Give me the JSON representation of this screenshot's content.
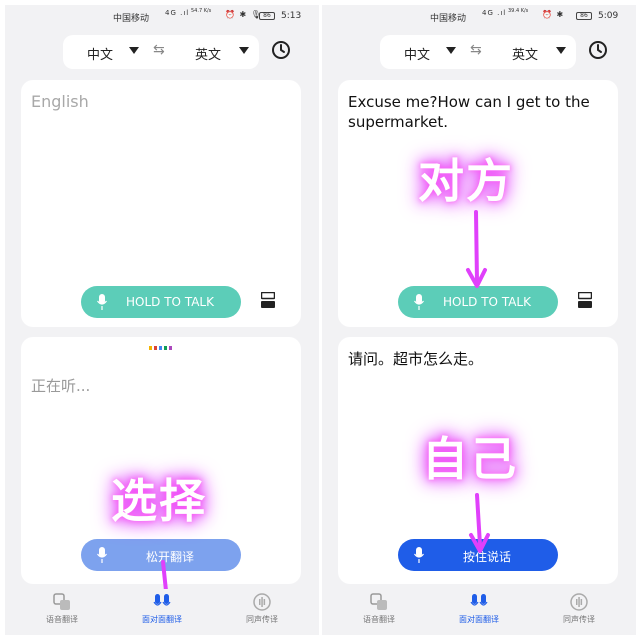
{
  "status_left": {
    "carrier": "中国移动",
    "net": "4G .ıl",
    "speed": "54.7 K/s",
    "icons": "⏰ ✱ 🎙",
    "battery": "86",
    "time": "5:13"
  },
  "status_right": {
    "carrier": "中国移动",
    "net": "4G .ıl",
    "speed": "39.4 K/s",
    "icons": "⏰ ✱",
    "battery": "86",
    "time": "5:09"
  },
  "lang": {
    "source": "中文",
    "target": "英文"
  },
  "left": {
    "top_hint": "English",
    "top_button": "HOLD TO TALK",
    "bottom_status": "正在听...",
    "bottom_button": "松开翻译",
    "overlay": "选择"
  },
  "right": {
    "top_text": "Excuse me?How can I get to the supermarket.",
    "top_button": "HOLD TO TALK",
    "bottom_text": "请问。超市怎么走。",
    "bottom_button": "按住说话",
    "overlay_top": "对方",
    "overlay_bottom": "自己"
  },
  "tabs": [
    "语音翻译",
    "面对面翻译",
    "同声传译"
  ],
  "colors": {
    "teal": "#5ccdb8",
    "blue": "#1f5de8",
    "light_blue": "#7da2ee",
    "magenta": "#e040fb"
  },
  "icons": [
    "history-icon",
    "swap-icon",
    "mic-icon",
    "layout-toggle-icon",
    "voice-translate-icon",
    "face-to-face-icon",
    "simultaneous-icon"
  ]
}
